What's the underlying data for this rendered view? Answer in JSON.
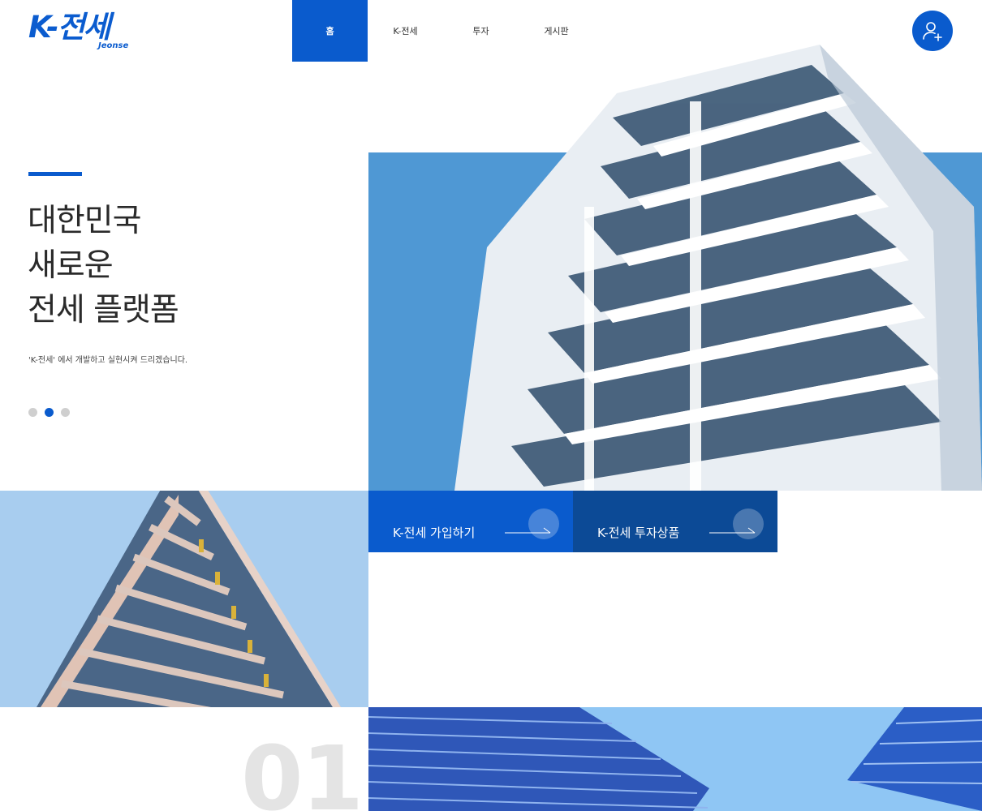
{
  "brand": {
    "name": "K-전세",
    "sub": "Jeonse",
    "color": "#0b5ccf"
  },
  "nav": {
    "items": [
      {
        "label": "홈",
        "active": true
      },
      {
        "label": "K-전세",
        "active": false
      },
      {
        "label": "투자",
        "active": false
      },
      {
        "label": "게시판",
        "active": false
      }
    ]
  },
  "user_button": {
    "icon": "user-plus-icon"
  },
  "hero": {
    "title_lines": [
      "대한민국",
      "새로운",
      "전세 플랫폼"
    ],
    "subtitle": "'K-전세' 에서 개발하고 실현시켜 드리겠습니다.",
    "slides": {
      "count": 3,
      "active": 2
    }
  },
  "cta": {
    "join_label": "K-전세 가입하기",
    "invest_label": "K-전세 투자상품"
  },
  "section_number": "01",
  "colors": {
    "primary": "#0a5bcd",
    "primary_dark": "#0c4a96",
    "sky": "#4f98d4",
    "light_sky": "#a8cdef"
  }
}
